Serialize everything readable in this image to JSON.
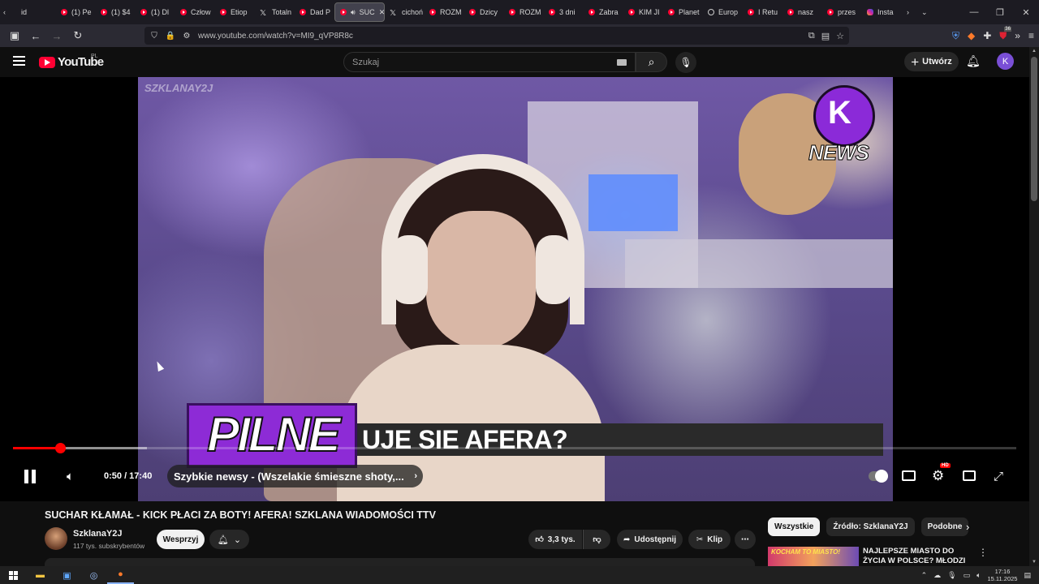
{
  "browser": {
    "tabs": [
      {
        "label": "id",
        "icon": "none"
      },
      {
        "label": "(1) Pe",
        "icon": "youtube"
      },
      {
        "label": "(1) $4",
        "icon": "youtube"
      },
      {
        "label": "(1) Dl",
        "icon": "youtube"
      },
      {
        "label": "Człow",
        "icon": "youtube"
      },
      {
        "label": "Etiop",
        "icon": "youtube"
      },
      {
        "label": "Totaln",
        "icon": "x"
      },
      {
        "label": "Dad P",
        "icon": "youtube"
      },
      {
        "label": "SUC",
        "icon": "youtube-active"
      },
      {
        "label": "cichoń",
        "icon": "x"
      },
      {
        "label": "ROZM",
        "icon": "youtube"
      },
      {
        "label": "Dzicy",
        "icon": "youtube"
      },
      {
        "label": "ROZM",
        "icon": "youtube"
      },
      {
        "label": "3 dni",
        "icon": "youtube"
      },
      {
        "label": "Zabra",
        "icon": "youtube"
      },
      {
        "label": "KIM JI",
        "icon": "youtube"
      },
      {
        "label": "Planet",
        "icon": "youtube"
      },
      {
        "label": "Europ",
        "icon": "globe"
      },
      {
        "label": "I Retu",
        "icon": "youtube"
      },
      {
        "label": "nasz",
        "icon": "youtube"
      },
      {
        "label": "przes",
        "icon": "youtube"
      },
      {
        "label": "Insta",
        "icon": "instagram"
      }
    ],
    "url": "www.youtube.com/watch?v=MI9_qVP8R8c",
    "extension_badge": "36"
  },
  "yt": {
    "logo_text": "YouTube",
    "country": "PL",
    "search_placeholder": "Szukaj",
    "create_label": "Utwórz",
    "avatar_letter": "K"
  },
  "player": {
    "watermark": "SZKLANAY2J",
    "overlay_logo": "NEWS",
    "overlay_logo_letter": "K",
    "pilne_label": "PILNE",
    "banner_text": "UJE SIE AFERA?",
    "time_current": "0:50",
    "time_total": "17:40",
    "time_display": "0:50 / 17:40",
    "progress_played": 0.0472,
    "progress_buffered": 0.1335,
    "chapter_title": "Szybkie newsy - (Wszelakie śmieszne shoty,...",
    "hd_badge": "HD"
  },
  "video": {
    "title": "SUCHAR KŁAMAŁ - KICK PŁACI ZA BOTY! AFERA! SZKLANA WIADOMOŚCI TTV",
    "channel": "SzklanaY2J",
    "subscribers": "117 tys. subskrybentów",
    "support_label": "Wesprzyj",
    "likes": "3,3 tys.",
    "share_label": "Udostępnij",
    "clip_label": "Klip"
  },
  "chips": [
    "Wszystkie",
    "Źródło: SzklanaY2J",
    "Podobne"
  ],
  "recommendation": {
    "title": "NAJLEPSZE MIASTO DO ŻYCIA W POLSCE? MŁODZI TU...",
    "thumb_text": "KOCHAM TO MIASTO!"
  },
  "taskbar": {
    "time": "17:16",
    "date": "15.11.2025"
  },
  "colors": {
    "accent": "#ff0000",
    "overlay_purple": "#8d2bd6",
    "background": "#0f0f0f"
  }
}
